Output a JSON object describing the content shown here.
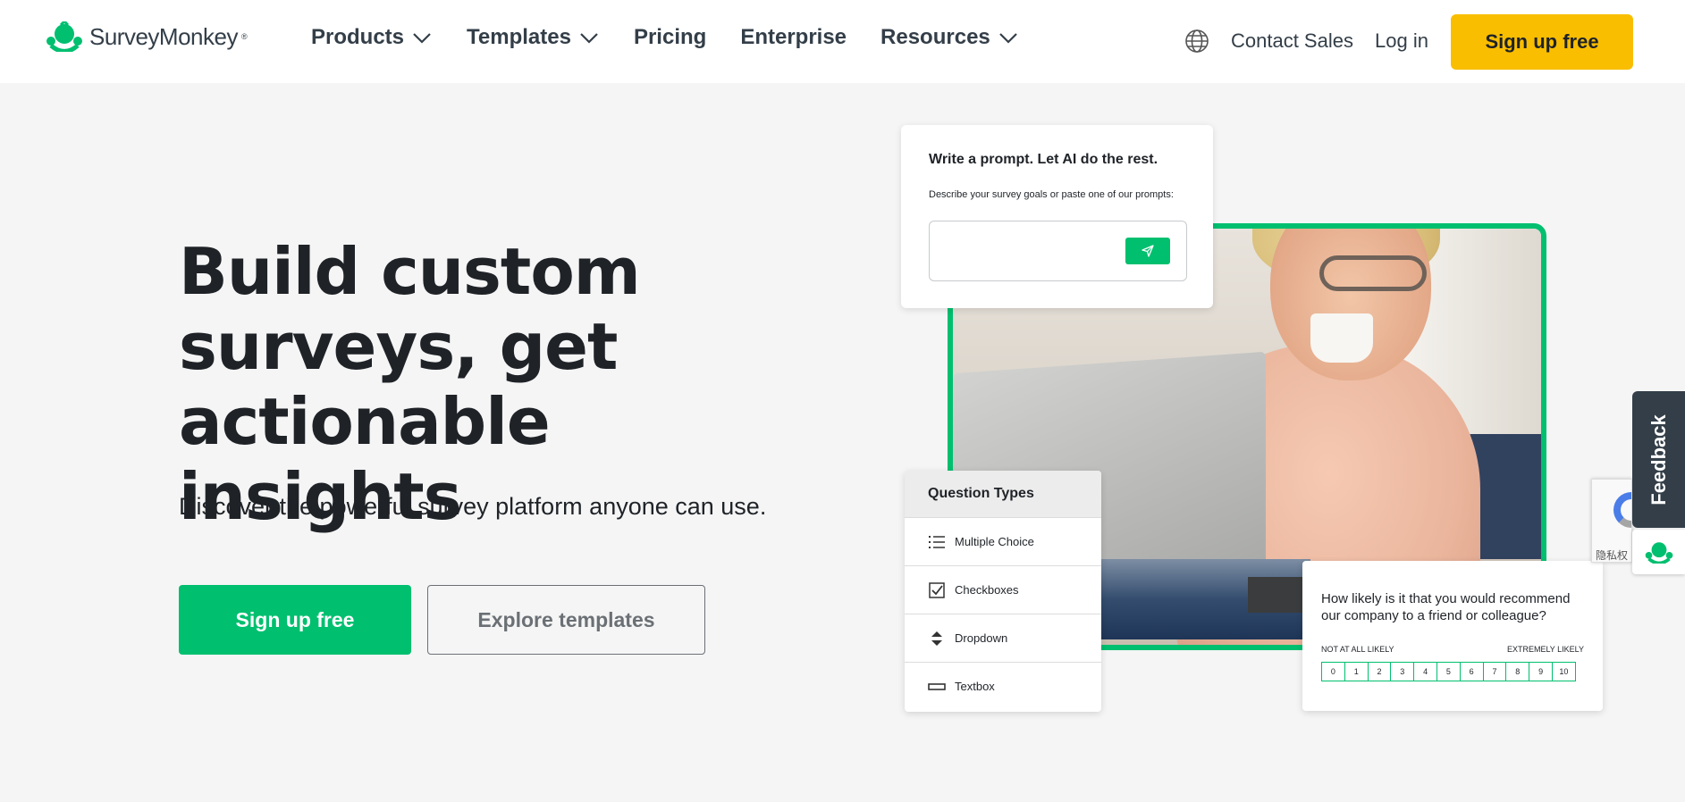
{
  "header": {
    "logo_text": "SurveyMonkey",
    "logo_mark": "®",
    "nav": [
      {
        "label": "Products",
        "has_dropdown": true
      },
      {
        "label": "Templates",
        "has_dropdown": true
      },
      {
        "label": "Pricing",
        "has_dropdown": false
      },
      {
        "label": "Enterprise",
        "has_dropdown": false
      },
      {
        "label": "Resources",
        "has_dropdown": true
      }
    ],
    "contact_sales": "Contact Sales",
    "login": "Log in",
    "signup": "Sign up free"
  },
  "hero": {
    "title": "Build custom surveys, get actionable insights",
    "subtitle": "Discover the powerful survey platform anyone can use.",
    "primary_cta": "Sign up free",
    "secondary_cta": "Explore templates"
  },
  "prompt_card": {
    "title": "Write a prompt. Let AI do the rest.",
    "description": "Describe your survey goals or paste one of our prompts:",
    "input_value": ""
  },
  "question_types": {
    "title": "Question Types",
    "items": [
      {
        "label": "Multiple Choice",
        "icon": "list-icon"
      },
      {
        "label": "Checkboxes",
        "icon": "checkbox-icon"
      },
      {
        "label": "Dropdown",
        "icon": "dropdown-icon"
      },
      {
        "label": "Textbox",
        "icon": "textbox-icon"
      }
    ]
  },
  "nps": {
    "question": "How likely is it that you would recommend our company to a friend or colleague?",
    "low_label": "NOT AT ALL LIKELY",
    "high_label": "EXTREMELY LIKELY",
    "scale": [
      "0",
      "1",
      "2",
      "3",
      "4",
      "5",
      "6",
      "7",
      "8",
      "9",
      "10"
    ]
  },
  "feedback_tab": "Feedback",
  "recaptcha_text": "隐私权",
  "colors": {
    "brand_green": "#00bf6f",
    "cta_yellow": "#f9be00",
    "text_dark": "#1f2328",
    "feedback_bg": "#333e48"
  }
}
